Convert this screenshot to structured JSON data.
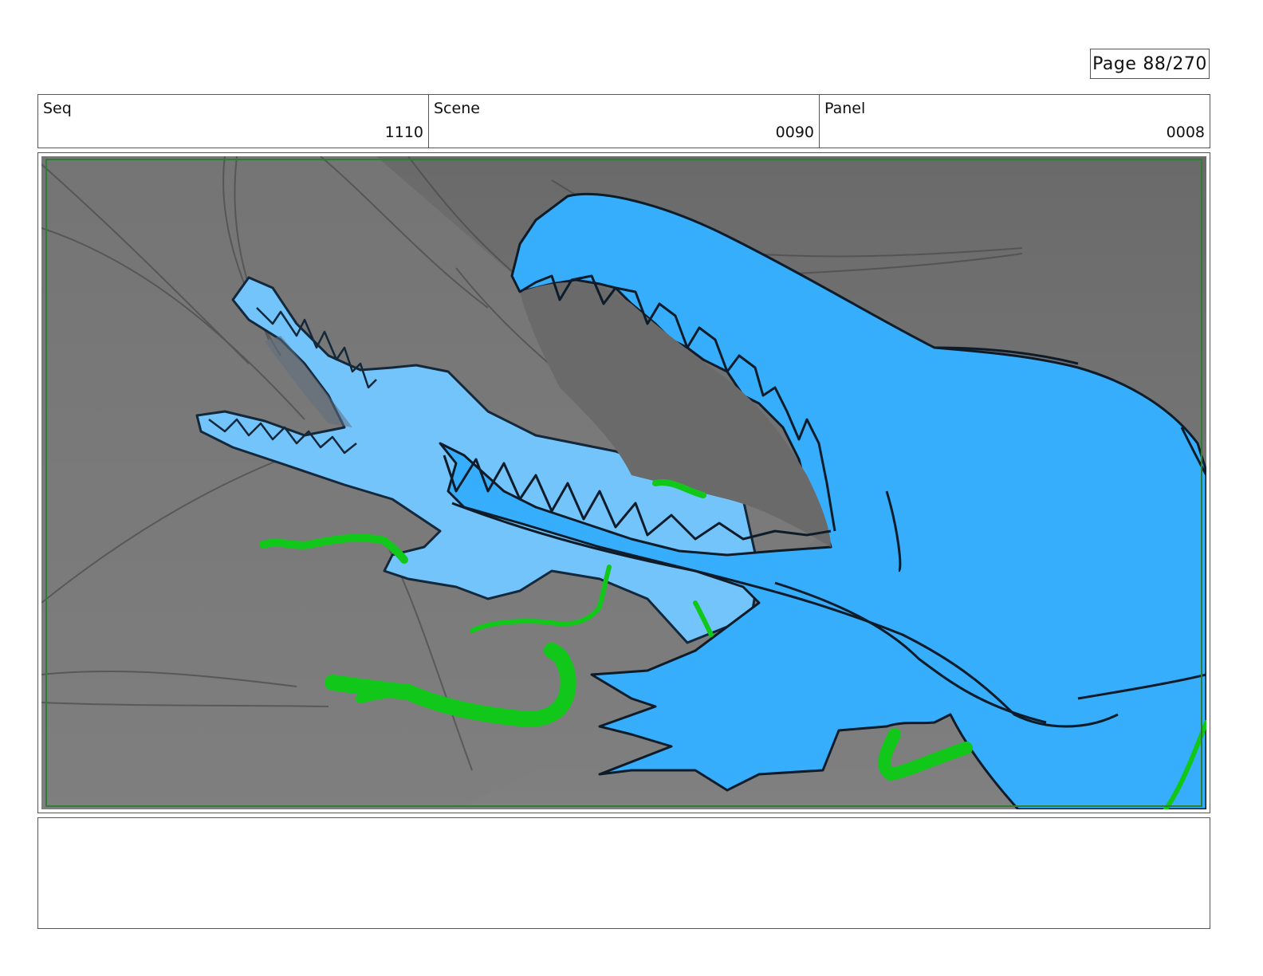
{
  "page": {
    "label": "Page",
    "number": "88/270"
  },
  "info": {
    "seq_label": "Seq",
    "seq_value": "1110",
    "scene_label": "Scene",
    "scene_value": "0090",
    "panel_label": "Panel",
    "panel_value": "0008"
  },
  "colors": {
    "background_dark": "#6a6a6a",
    "background_light": "#7d7d7d",
    "creature_blue": "#36aefc",
    "creature_light_blue": "#74c4fc",
    "kelp_green": "#11c81a",
    "safe_area_green": "#2e7d32",
    "ink": "#0e1c2a"
  },
  "notes": {
    "text": ""
  }
}
